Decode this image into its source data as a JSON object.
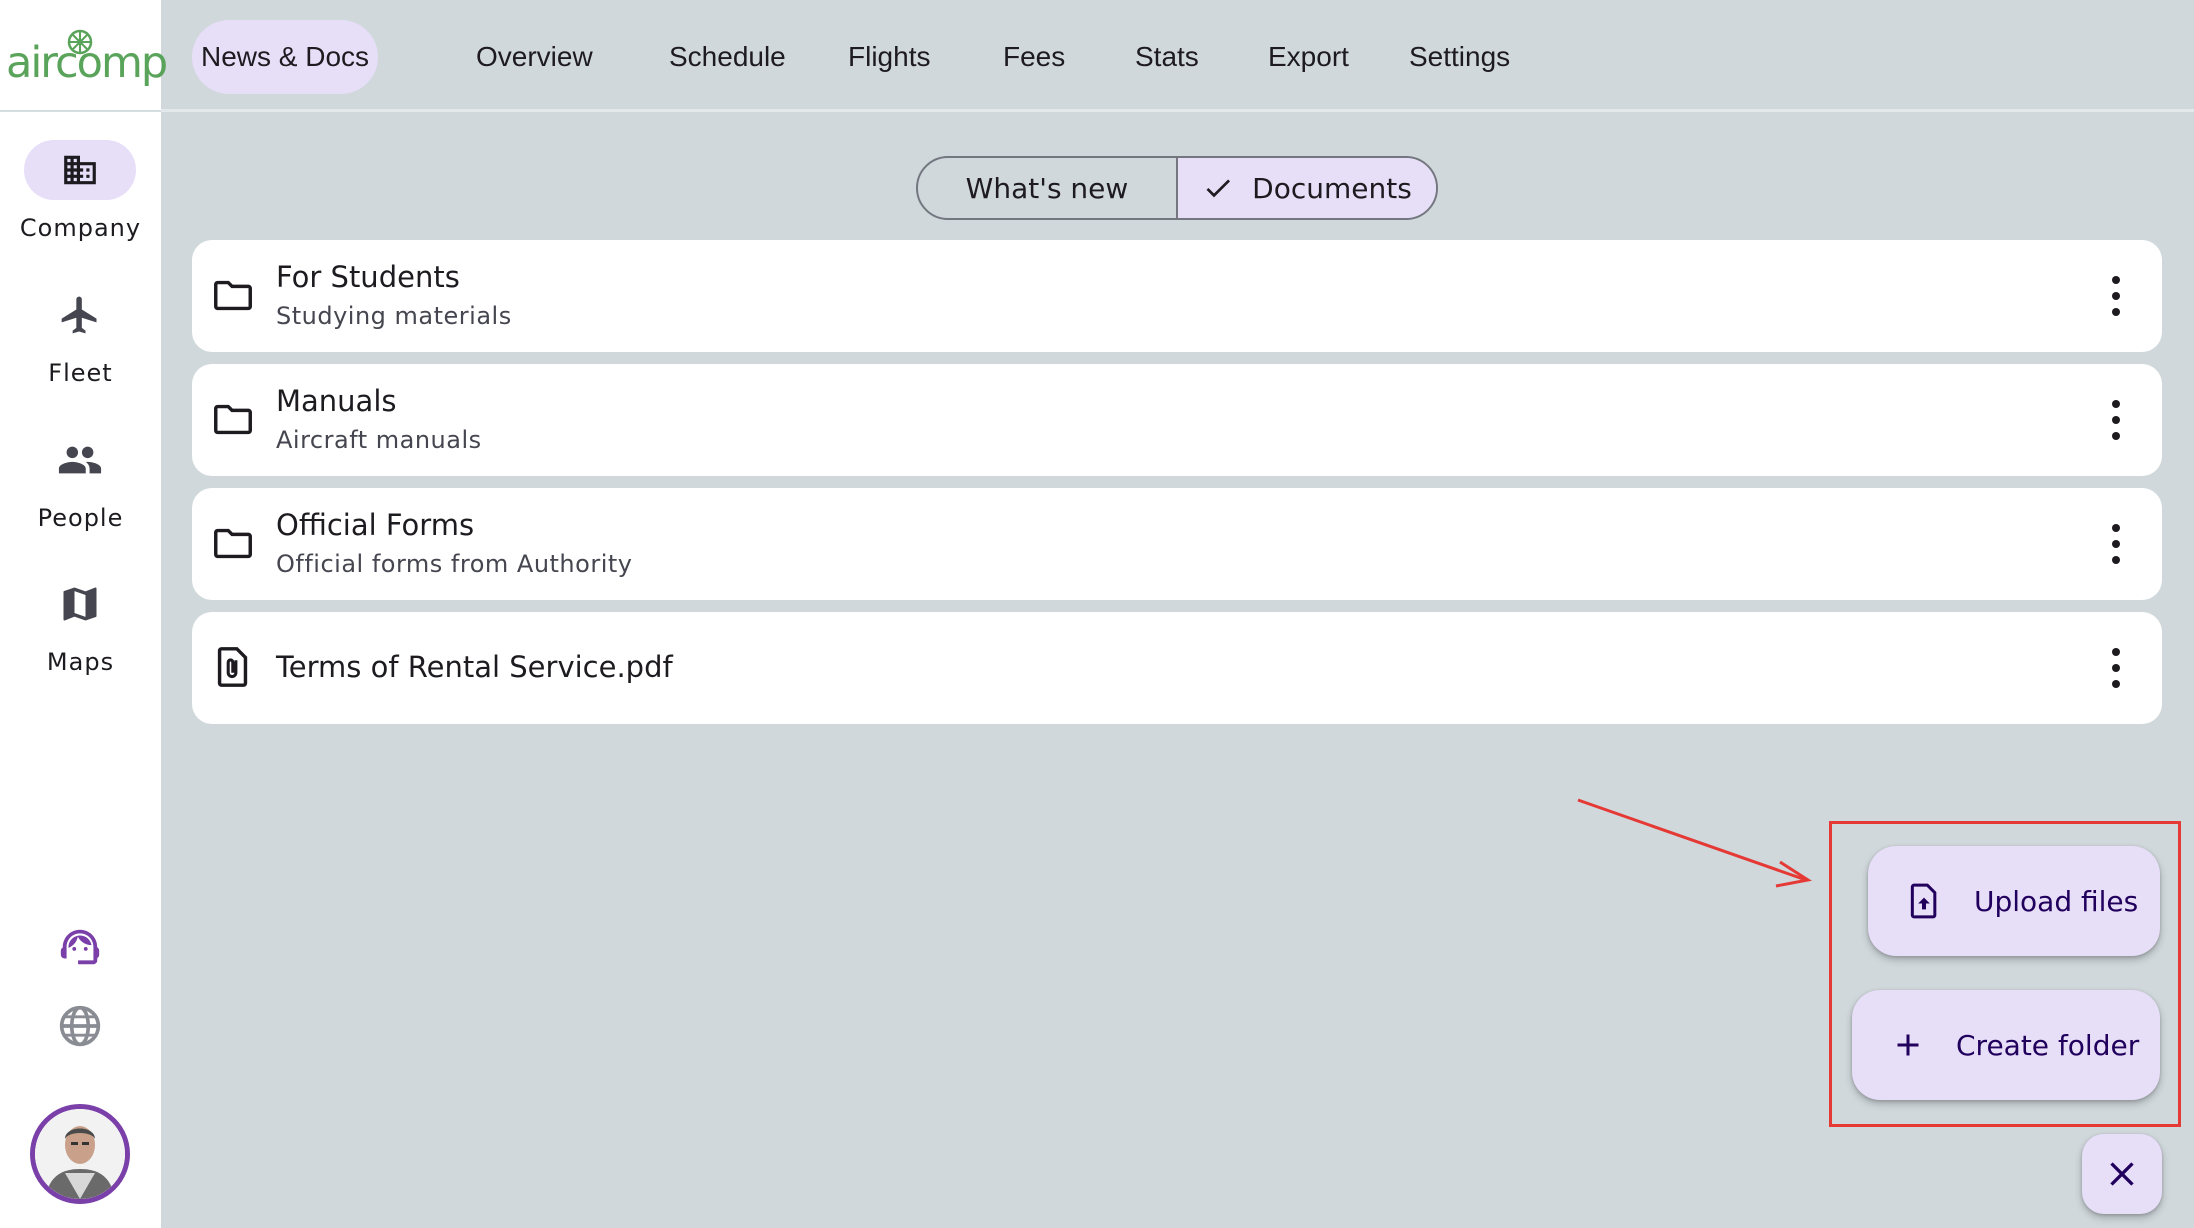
{
  "sidebar": {
    "logo": "aircomp",
    "items": [
      {
        "label": "Company",
        "icon": "building-icon",
        "active": true
      },
      {
        "label": "Fleet",
        "icon": "airplane-icon",
        "active": false
      },
      {
        "label": "People",
        "icon": "people-icon",
        "active": false
      },
      {
        "label": "Maps",
        "icon": "map-icon",
        "active": false
      }
    ]
  },
  "top_tabs": [
    {
      "label": "News & Docs",
      "active": true
    },
    {
      "label": "Overview"
    },
    {
      "label": "Schedule"
    },
    {
      "label": "Flights"
    },
    {
      "label": "Fees"
    },
    {
      "label": "Stats"
    },
    {
      "label": "Export"
    },
    {
      "label": "Settings"
    }
  ],
  "segmented": {
    "left": "What's new",
    "right": "Documents",
    "selected": "Documents"
  },
  "documents": [
    {
      "title": "For Students",
      "subtitle": "Studying materials",
      "icon": "folder-icon"
    },
    {
      "title": "Manuals",
      "subtitle": "Aircraft manuals",
      "icon": "folder-icon"
    },
    {
      "title": "Official Forms",
      "subtitle": "Official forms from Authority",
      "icon": "folder-icon"
    },
    {
      "title": "Terms of Rental Service.pdf",
      "subtitle": "",
      "icon": "file-attachment-icon"
    }
  ],
  "fab": {
    "upload_label": "Upload files",
    "create_label": "Create folder"
  },
  "colors": {
    "accent_container": "#e7def8",
    "background": "#d0d8dc",
    "brand_green": "#5aa35a",
    "highlight_red": "#e53935"
  }
}
